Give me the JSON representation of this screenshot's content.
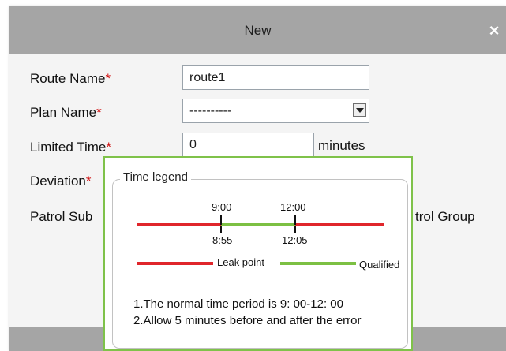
{
  "dialog": {
    "title": "New",
    "close_label": "×"
  },
  "form": {
    "route_name": {
      "label": "Route Name",
      "required": "*",
      "value": "route1"
    },
    "plan_name": {
      "label": "Plan Name",
      "required": "*",
      "value": "----------"
    },
    "limited_time": {
      "label": "Limited Time",
      "required": "*",
      "value": "0",
      "unit": "minutes"
    },
    "deviation": {
      "label": "Deviation",
      "required": "*"
    },
    "patrol_subject": {
      "label": "Patrol Sub"
    },
    "patrol_group": {
      "label": "trol Group"
    }
  },
  "time_legend": {
    "title": "Time legend",
    "top_labels": [
      "9:00",
      "12:00"
    ],
    "bottom_labels": [
      "8:55",
      "12:05"
    ],
    "leak_label": "Leak point",
    "qualified_label": "Qualified",
    "notes": [
      "1.The normal time period is 9: 00-12: 00",
      "2.Allow 5 minutes before and after the error"
    ],
    "colors": {
      "leak": "#e0262b",
      "qualified": "#7cc043"
    }
  }
}
